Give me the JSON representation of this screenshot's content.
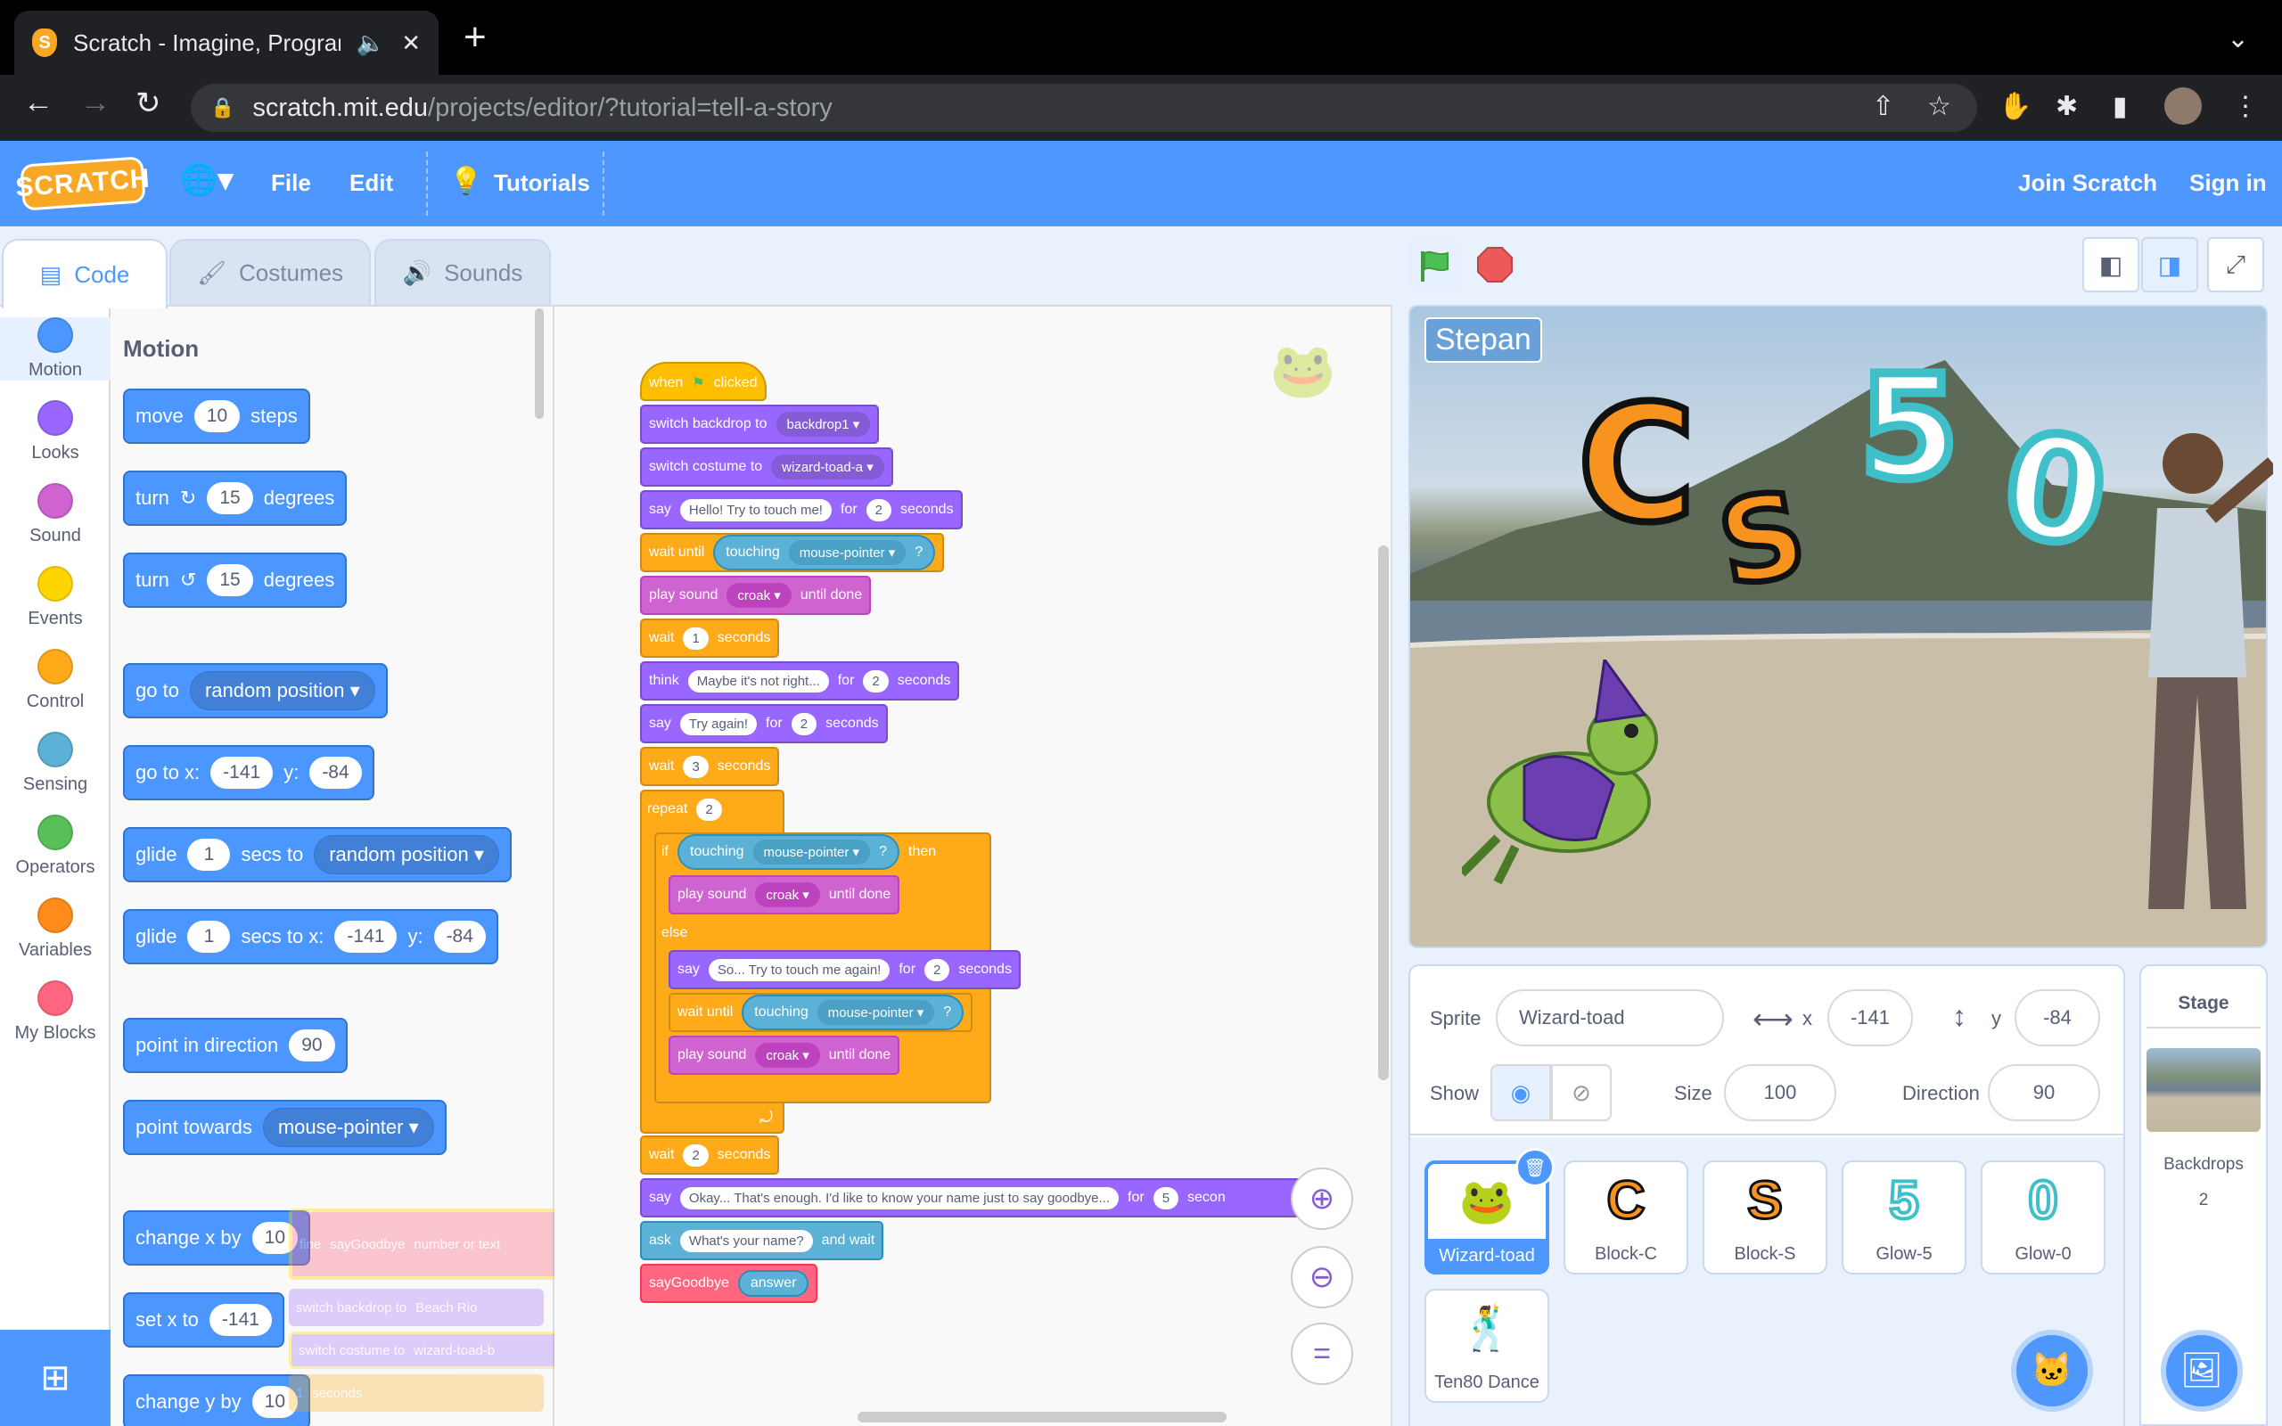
{
  "browser": {
    "tab_title": "Scratch - Imagine, Program",
    "url_host": "scratch.mit.edu",
    "url_path": "/projects/editor/?tutorial=tell-a-story"
  },
  "menu": {
    "file": "File",
    "edit": "Edit",
    "tutorials": "Tutorials",
    "join": "Join Scratch",
    "signin": "Sign in",
    "logo": "SCRATCH"
  },
  "tabs": {
    "code": "Code",
    "costumes": "Costumes",
    "sounds": "Sounds"
  },
  "categories": [
    {
      "label": "Motion",
      "color": "#4c97ff"
    },
    {
      "label": "Looks",
      "color": "#9966ff"
    },
    {
      "label": "Sound",
      "color": "#cf63cf"
    },
    {
      "label": "Events",
      "color": "#ffd500"
    },
    {
      "label": "Control",
      "color": "#ffab19"
    },
    {
      "label": "Sensing",
      "color": "#5cb1d6"
    },
    {
      "label": "Operators",
      "color": "#59c059"
    },
    {
      "label": "Variables",
      "color": "#ff8c1a"
    },
    {
      "label": "My Blocks",
      "color": "#ff6680"
    }
  ],
  "palette": {
    "title": "Motion",
    "move": "move",
    "move_val": "10",
    "steps": "steps",
    "turn": "turn",
    "turn_val": "15",
    "degrees": "degrees",
    "goto": "go to",
    "random": "random position",
    "gotoxy": "go to x:",
    "x": "-141",
    "y_lbl": "y:",
    "y": "-84",
    "glide": "glide",
    "glide_val": "1",
    "secs_to": "secs to",
    "secs_to_x": "secs to x:",
    "point_dir": "point in direction",
    "dir": "90",
    "point_towards": "point towards",
    "mouse": "mouse-pointer",
    "change_x": "change x by",
    "set_x": "set x to",
    "change_y": "change y by",
    "ten": "10"
  },
  "script": {
    "when": "when",
    "clicked": "clicked",
    "switch_backdrop": "switch backdrop to",
    "backdrop1": "backdrop1",
    "switch_costume": "switch costume to",
    "costume_a": "wizard-toad-a",
    "say": "say",
    "hello": "Hello! Try to touch me!",
    "for": "for",
    "two": "2",
    "seconds": "seconds",
    "wait_until": "wait until",
    "touching": "touching",
    "mouse": "mouse-pointer",
    "q": "?",
    "play_sound": "play sound",
    "croak": "croak",
    "until_done": "until done",
    "wait": "wait",
    "one": "1",
    "think": "think",
    "maybe": "Maybe it's not right...",
    "try_again": "Try again!",
    "three": "3",
    "repeat": "repeat",
    "if": "if",
    "then": "then",
    "else": "else",
    "so": "So... Try to touch me again!",
    "okay": "Okay... That's enough. I'd like to know your name just to say goodbye...",
    "five": "5",
    "secon": "secon",
    "ask": "ask",
    "whats_name": "What's your name?",
    "and_wait": "and wait",
    "say_goodbye": "sayGoodbye",
    "answer": "answer"
  },
  "ghost": {
    "define": "fine",
    "saygb": "sayGoodbye",
    "number_text": "number or text",
    "beach": "Beach Rio",
    "costume_b": "wizard-toad-b",
    "seconds": "seconds",
    "one": "1"
  },
  "stage": {
    "var_label": "Stepan"
  },
  "sprite": {
    "label": "Sprite",
    "name": "Wizard-toad",
    "x_lbl": "x",
    "x": "-141",
    "y_lbl": "y",
    "y": "-84",
    "show": "Show",
    "size_lbl": "Size",
    "size": "100",
    "dir_lbl": "Direction",
    "dir": "90"
  },
  "sprites": [
    {
      "name": "Wizard-toad",
      "glyph": ""
    },
    {
      "name": "Block-C",
      "glyph": "C"
    },
    {
      "name": "Block-S",
      "glyph": "S"
    },
    {
      "name": "Glow-5",
      "glyph": "5"
    },
    {
      "name": "Glow-0",
      "glyph": "0"
    },
    {
      "name": "Ten80 Dance",
      "glyph": ""
    }
  ],
  "stagepane": {
    "title": "Stage",
    "backdrops": "Backdrops",
    "count": "2"
  }
}
